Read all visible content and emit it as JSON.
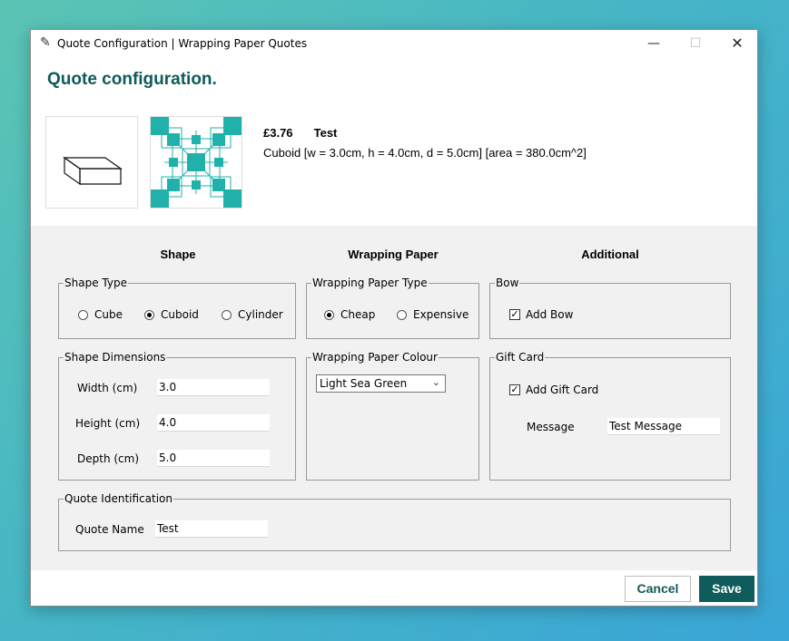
{
  "window": {
    "title": "Quote Configuration | Wrapping Paper Quotes",
    "minimize_icon": "minimize-icon",
    "maximize_icon": "maximize-icon",
    "close_icon": "close-icon"
  },
  "heading": "Quote configuration.",
  "summary": {
    "price": "£3.76",
    "name": "Test",
    "description": "Cuboid [w = 3.0cm, h = 4.0cm, d = 5.0cm] [area = 380.0cm^2]"
  },
  "preview": {
    "shape_icon": "cuboid-wireframe-icon",
    "paper_icon": "wrapping-paper-pattern-icon",
    "paper_color": "#20b2aa"
  },
  "columns": {
    "shape": "Shape",
    "wrapping_paper": "Wrapping Paper",
    "additional": "Additional"
  },
  "shape_type": {
    "legend": "Shape Type",
    "options": [
      "Cube",
      "Cuboid",
      "Cylinder"
    ],
    "selected": "Cuboid"
  },
  "paper_type": {
    "legend": "Wrapping Paper Type",
    "options": [
      "Cheap",
      "Expensive"
    ],
    "selected": "Cheap"
  },
  "bow": {
    "legend": "Bow",
    "checkbox_label": "Add Bow",
    "checked": true
  },
  "dimensions": {
    "legend": "Shape Dimensions",
    "width_label": "Width (cm)",
    "width_value": "3.0",
    "height_label": "Height (cm)",
    "height_value": "4.0",
    "depth_label": "Depth (cm)",
    "depth_value": "5.0"
  },
  "paper_colour": {
    "legend": "Wrapping Paper Colour",
    "selected": "Light Sea Green"
  },
  "gift_card": {
    "legend": "Gift Card",
    "checkbox_label": "Add Gift Card",
    "checked": true,
    "message_label": "Message",
    "message_value": "Test Message"
  },
  "quote_id": {
    "legend": "Quote Identification",
    "name_label": "Quote Name",
    "name_value": "Test"
  },
  "buttons": {
    "cancel": "Cancel",
    "save": "Save"
  },
  "colors": {
    "accent": "#0f5a5a",
    "panel_bg": "#f1f1f1"
  }
}
